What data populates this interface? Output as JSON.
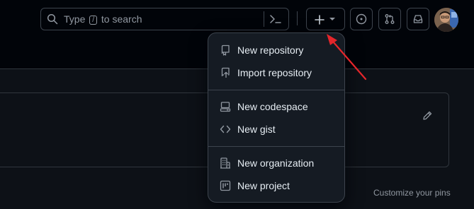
{
  "header": {
    "search": {
      "prefix": "Type",
      "key": "/",
      "suffix": "to search"
    }
  },
  "menu": {
    "items": [
      {
        "label": "New repository",
        "icon": "repo-icon"
      },
      {
        "label": "Import repository",
        "icon": "repo-push-icon"
      },
      {
        "label": "New codespace",
        "icon": "codespaces-icon"
      },
      {
        "label": "New gist",
        "icon": "code-icon"
      },
      {
        "label": "New organization",
        "icon": "organization-icon"
      },
      {
        "label": "New project",
        "icon": "project-icon"
      }
    ]
  },
  "dashboard": {
    "customize_pins": "Customize your pins"
  },
  "colors": {
    "background": "#0d1117",
    "header": "#010409",
    "menu": "#151b23",
    "border": "#3d444d",
    "annotation_arrow": "#e5262b"
  }
}
